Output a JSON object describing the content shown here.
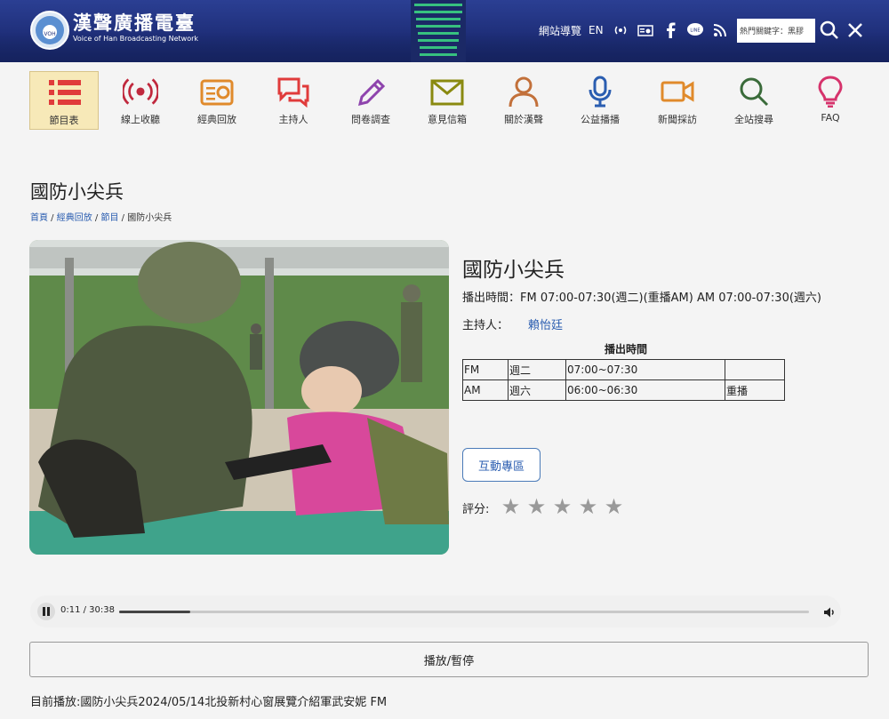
{
  "header": {
    "logo_cn": "漢聲廣播電臺",
    "logo_en": "Voice of Han Broadcasting Network",
    "sitemap": "網站導覽",
    "lang": "EN",
    "search_value": "熱門關鍵字：黑膠"
  },
  "nav": {
    "items": [
      {
        "label": "節目表",
        "icon": "list-icon",
        "color": "#e03b3b"
      },
      {
        "label": "線上收聽",
        "icon": "broadcast-icon",
        "color": "#c0283d"
      },
      {
        "label": "經典回放",
        "icon": "radio-icon",
        "color": "#e08a2b"
      },
      {
        "label": "主持人",
        "icon": "chat-bubbles-icon",
        "color": "#e03b3b"
      },
      {
        "label": "問卷調查",
        "icon": "pencil-icon",
        "color": "#8e44ad"
      },
      {
        "label": "意見信箱",
        "icon": "mail-icon",
        "color": "#8a8a10"
      },
      {
        "label": "關於漢聲",
        "icon": "person-icon",
        "color": "#c2703a"
      },
      {
        "label": "公益播播",
        "icon": "microphone-icon",
        "color": "#2a5db0"
      },
      {
        "label": "新聞採訪",
        "icon": "video-camera-icon",
        "color": "#e08a2b"
      },
      {
        "label": "全站搜尋",
        "icon": "search-icon",
        "color": "#3a6b3a"
      },
      {
        "label": "FAQ",
        "icon": "lightbulb-icon",
        "color": "#d6336c"
      }
    ]
  },
  "page": {
    "title": "國防小尖兵",
    "breadcrumb": [
      "首頁",
      "經典回放",
      "節目",
      "國防小尖兵"
    ]
  },
  "program": {
    "title": "國防小尖兵",
    "airtime": "播出時間：FM 07:00-07:30(週二)(重播AM)  AM 07:00-07:30(週六)",
    "host_label": "主持人：",
    "host_name": "賴怡廷",
    "schedule_caption": "播出時間",
    "schedule": [
      [
        "FM",
        "週二",
        "07:00~07:30",
        ""
      ],
      [
        "AM",
        "週六",
        "06:00~06:30",
        "重播"
      ]
    ],
    "interact_button": "互動專區",
    "rating_label": "評分:",
    "rating_max": 5
  },
  "player": {
    "time": "0:11 / 30:38",
    "progress_fraction": 0.006,
    "play_pause_label": "播放/暫停",
    "now_playing": "目前播放:國防小尖兵2024/05/14北投新村心窗展覽介紹軍武安妮 FM"
  }
}
